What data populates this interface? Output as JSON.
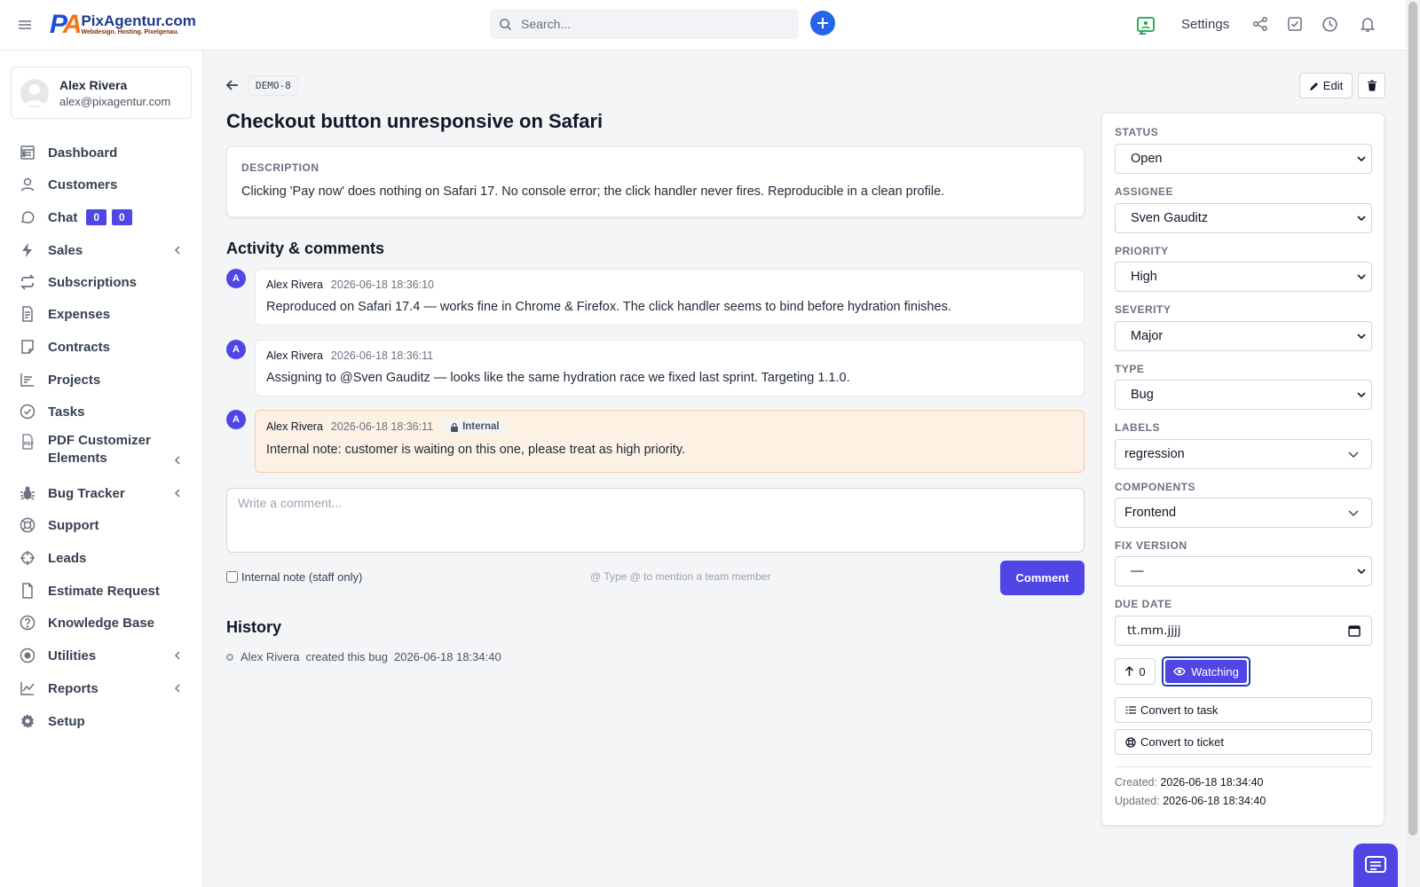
{
  "app": {
    "logo_mark": "PA",
    "logo_name": "PixAgentur.com",
    "logo_tagline": "Webdesign. Hosting. Pixelgenau."
  },
  "topbar": {
    "search_placeholder": "Search...",
    "settings_label": "Settings"
  },
  "user": {
    "name": "Alex Rivera",
    "email": "alex@pixagentur.com"
  },
  "nav": [
    {
      "label": "Dashboard",
      "icon": "dashboard-icon"
    },
    {
      "label": "Customers",
      "icon": "user-icon"
    },
    {
      "label": "Chat",
      "icon": "chat-bubble-icon",
      "badges": [
        "0",
        "0"
      ]
    },
    {
      "label": "Sales",
      "icon": "bolt-icon",
      "expandable": true
    },
    {
      "label": "Subscriptions",
      "icon": "repeat-icon"
    },
    {
      "label": "Expenses",
      "icon": "file-text-icon"
    },
    {
      "label": "Contracts",
      "icon": "contract-icon"
    },
    {
      "label": "Projects",
      "icon": "chart-bars-icon"
    },
    {
      "label": "Tasks",
      "icon": "check-circle-icon"
    },
    {
      "label": "PDF Customizer Elements",
      "icon": "pdf-icon",
      "expandable": true
    },
    {
      "label": "Bug Tracker",
      "icon": "bug-icon",
      "expandable": true
    },
    {
      "label": "Support",
      "icon": "lifebuoy-icon"
    },
    {
      "label": "Leads",
      "icon": "crosshair-icon"
    },
    {
      "label": "Estimate Request",
      "icon": "file-icon"
    },
    {
      "label": "Knowledge Base",
      "icon": "question-circle-icon"
    },
    {
      "label": "Utilities",
      "icon": "radio-circle-icon",
      "expandable": true
    },
    {
      "label": "Reports",
      "icon": "line-chart-icon",
      "expandable": true
    },
    {
      "label": "Setup",
      "icon": "gear-icon"
    }
  ],
  "bug": {
    "key": "DEMO-8",
    "title": "Checkout button unresponsive on Safari",
    "description_label": "DESCRIPTION",
    "description": "Clicking 'Pay now' does nothing on Safari 17. No console error; the click handler never fires. Reproducible in a clean profile.",
    "edit_label": "Edit"
  },
  "activity": {
    "title": "Activity & comments",
    "comments": [
      {
        "avatar": "A",
        "author": "Alex Rivera",
        "date": "2026-06-18 18:36:10",
        "text": "Reproduced on Safari 17.4 — works fine in Chrome & Firefox. The click handler seems to bind before hydration finishes.",
        "internal": false
      },
      {
        "avatar": "A",
        "author": "Alex Rivera",
        "date": "2026-06-18 18:36:11",
        "text": "Assigning to @Sven Gauditz — looks like the same hydration race we fixed last sprint. Targeting 1.1.0.",
        "internal": false
      },
      {
        "avatar": "A",
        "author": "Alex Rivera",
        "date": "2026-06-18 18:36:11",
        "text": "Internal note: customer is waiting on this one, please treat as high priority.",
        "internal": true,
        "badge": "Internal"
      }
    ],
    "comment_placeholder": "Write a comment...",
    "internal_note_label": "Internal note (staff only)",
    "mention_hint": "@ Type @ to mention a team member",
    "comment_button": "Comment"
  },
  "history": {
    "title": "History",
    "items": [
      {
        "author": "Alex Rivera",
        "action": "created this bug",
        "date": "2026-06-18 18:34:40"
      }
    ]
  },
  "panel": {
    "status_label": "STATUS",
    "status": "Open",
    "assignee_label": "ASSIGNEE",
    "assignee": "Sven Gauditz",
    "priority_label": "PRIORITY",
    "priority": "High",
    "severity_label": "SEVERITY",
    "severity": "Major",
    "type_label": "TYPE",
    "type": "Bug",
    "labels_label": "LABELS",
    "labels": "regression",
    "components_label": "COMPONENTS",
    "components": "Frontend",
    "fix_version_label": "FIX VERSION",
    "fix_version": "—",
    "due_date_label": "DUE DATE",
    "due_date_placeholder": "tt.mm.jjjj",
    "votes": "0",
    "watch_label": "Watching",
    "convert_task": "Convert to task",
    "convert_ticket": "Convert to ticket",
    "created_label": "Created:",
    "created": "2026-06-18 18:34:40",
    "updated_label": "Updated:",
    "updated": "2026-06-18 18:34:40"
  },
  "colors": {
    "accent": "#4f46e5",
    "primary_blue": "#2563eb",
    "internal_bg": "#fdf1e4"
  }
}
